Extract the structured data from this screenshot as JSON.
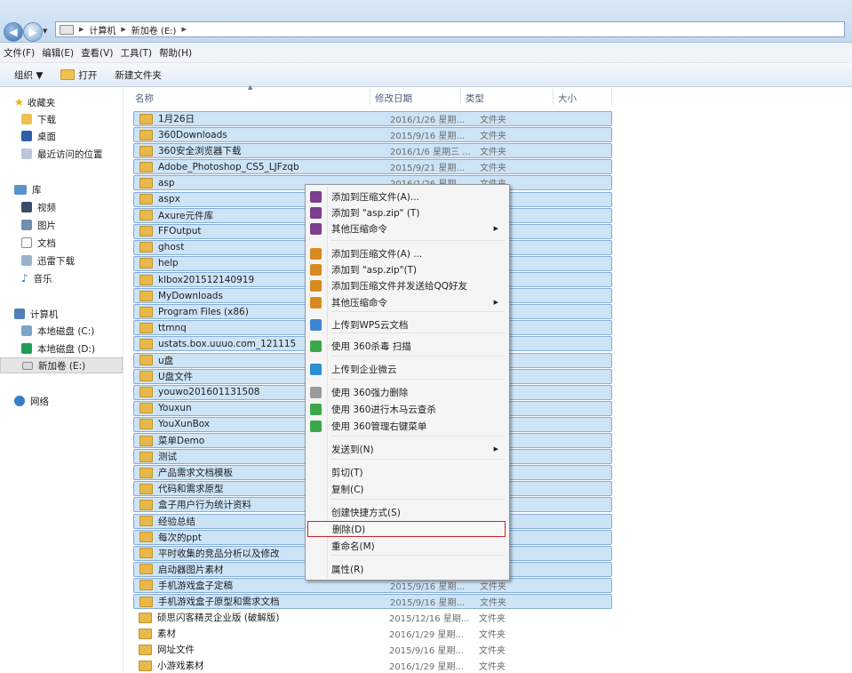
{
  "address": {
    "crumbs": [
      "计算机",
      "新加卷 (E:)"
    ]
  },
  "menubar": [
    "文件(F)",
    "编辑(E)",
    "查看(V)",
    "工具(T)",
    "帮助(H)"
  ],
  "toolbar": {
    "organize": "组织 ▼",
    "open": "打开",
    "new_folder": "新建文件夹"
  },
  "nav": {
    "favorites": "收藏夹",
    "downloads": "下载",
    "desktop": "桌面",
    "recent": "最近访问的位置",
    "libraries": "库",
    "videos": "视频",
    "pictures": "图片",
    "documents": "文档",
    "xunlei": "迅雷下载",
    "music": "音乐",
    "computer": "计算机",
    "drive_c": "本地磁盘 (C:)",
    "drive_d": "本地磁盘 (D:)",
    "drive_e": "新加卷 (E:)",
    "network": "网络"
  },
  "columns": {
    "name": "名称",
    "date": "修改日期",
    "type": "类型",
    "size": "大小"
  },
  "files": [
    {
      "name": "1月26日",
      "date": "2016/1/26 星期...",
      "type": "文件夹",
      "selected": true
    },
    {
      "name": "360Downloads",
      "date": "2015/9/16 星期...",
      "type": "文件夹",
      "selected": true
    },
    {
      "name": "360安全浏览器下载",
      "date": "2016/1/6 星期三 ...",
      "type": "文件夹",
      "selected": true
    },
    {
      "name": "Adobe_Photoshop_CS5_LJFzqb",
      "date": "2015/9/21 星期...",
      "type": "文件夹",
      "selected": true
    },
    {
      "name": "asp",
      "date": "2016/1/26 星期...",
      "type": "文件夹",
      "selected": true
    },
    {
      "name": "aspx",
      "date": "",
      "type": "",
      "selected": true
    },
    {
      "name": "Axure元件库",
      "date": "",
      "type": "",
      "selected": true
    },
    {
      "name": "FFOutput",
      "date": "",
      "type": "",
      "selected": true
    },
    {
      "name": "ghost",
      "date": "",
      "type": "",
      "selected": true
    },
    {
      "name": "help",
      "date": "",
      "type": "",
      "selected": true
    },
    {
      "name": "klbox201512140919",
      "date": "",
      "type": "",
      "selected": true
    },
    {
      "name": "MyDownloads",
      "date": "",
      "type": "",
      "selected": true
    },
    {
      "name": "Program Files (x86)",
      "date": "",
      "type": "",
      "selected": true
    },
    {
      "name": "ttmnq",
      "date": "",
      "type": "",
      "selected": true
    },
    {
      "name": "ustats.box.uuuo.com_121115",
      "date": "",
      "type": "",
      "selected": true
    },
    {
      "name": "u盘",
      "date": "",
      "type": "",
      "selected": true
    },
    {
      "name": "U盘文件",
      "date": "",
      "type": "",
      "selected": true
    },
    {
      "name": "youwo201601131508",
      "date": "",
      "type": "",
      "selected": true
    },
    {
      "name": "Youxun",
      "date": "",
      "type": "",
      "selected": true
    },
    {
      "name": "YouXunBox",
      "date": "",
      "type": "",
      "selected": true
    },
    {
      "name": "菜单Demo",
      "date": "",
      "type": "",
      "selected": true
    },
    {
      "name": "测试",
      "date": "",
      "type": "",
      "selected": true
    },
    {
      "name": "产品需求文档模板",
      "date": "",
      "type": "",
      "selected": true
    },
    {
      "name": "代码和需求原型",
      "date": "",
      "type": "",
      "selected": true
    },
    {
      "name": "盒子用户行为统计资料",
      "date": "",
      "type": "",
      "selected": true
    },
    {
      "name": "经验总结",
      "date": "",
      "type": "",
      "selected": true
    },
    {
      "name": "每次的ppt",
      "date": "",
      "type": "",
      "selected": true
    },
    {
      "name": "平时收集的竞品分析以及修改",
      "date": "",
      "type": "",
      "selected": true
    },
    {
      "name": "启动器图片素材",
      "date": "",
      "type": "",
      "selected": true
    },
    {
      "name": "手机游戏盒子定稿",
      "date": "2015/9/16 星期...",
      "type": "文件夹",
      "selected": true
    },
    {
      "name": "手机游戏盒子原型和需求文档",
      "date": "2015/9/16 星期...",
      "type": "文件夹",
      "selected": true
    },
    {
      "name": "硕思闪客精灵企业版 (破解版)",
      "date": "2015/12/16 星期...",
      "type": "文件夹",
      "selected": false
    },
    {
      "name": "素材",
      "date": "2016/1/29 星期...",
      "type": "文件夹",
      "selected": false
    },
    {
      "name": "网址文件",
      "date": "2015/9/16 星期...",
      "type": "文件夹",
      "selected": false
    },
    {
      "name": "小游戏素材",
      "date": "2016/1/29 星期...",
      "type": "文件夹",
      "selected": false
    }
  ],
  "context_menu": {
    "items": [
      {
        "label": "添加到压缩文件(A)...",
        "icon": "winrar-icon",
        "sub": false
      },
      {
        "label": "添加到 \"asp.zip\" (T)",
        "icon": "winrar-icon",
        "sub": false
      },
      {
        "label": "其他压缩命令",
        "icon": "winrar-icon",
        "sub": true
      },
      {
        "label": "添加到压缩文件(A) ...",
        "icon": "archive-icon",
        "sub": false
      },
      {
        "label": "添加到 \"asp.zip\"(T)",
        "icon": "archive-icon",
        "sub": false
      },
      {
        "label": "添加到压缩文件并发送给QQ好友",
        "icon": "archive-icon",
        "sub": false
      },
      {
        "label": "其他压缩命令",
        "icon": "archive-icon",
        "sub": true
      },
      {
        "label": "上传到WPS云文档",
        "icon": "wps-cloud-icon",
        "sub": false
      },
      {
        "label": "使用 360杀毒 扫描",
        "icon": "360-shield-icon",
        "sub": false
      },
      {
        "label": "上传到企业微云",
        "icon": "weiyun-icon",
        "sub": false
      },
      {
        "label": "使用 360强力删除",
        "icon": "shredder-icon",
        "sub": false
      },
      {
        "label": "使用 360进行木马云查杀",
        "icon": "360-trojan-icon",
        "sub": false
      },
      {
        "label": "使用 360管理右键菜单",
        "icon": "360-menu-icon",
        "sub": false
      },
      {
        "label": "发送到(N)",
        "icon": "",
        "sub": true
      },
      {
        "label": "剪切(T)",
        "icon": "",
        "sub": false
      },
      {
        "label": "复制(C)",
        "icon": "",
        "sub": false
      },
      {
        "label": "创建快捷方式(S)",
        "icon": "",
        "sub": false
      },
      {
        "label": "删除(D)",
        "icon": "",
        "sub": false,
        "highlighted": true
      },
      {
        "label": "重命名(M)",
        "icon": "",
        "sub": false
      },
      {
        "label": "属性(R)",
        "icon": "",
        "sub": false
      }
    ]
  },
  "colors": {
    "selection_bg": "#cde4f7",
    "selection_border": "#84acdd",
    "highlight_border": "#c8252b",
    "folder": "#e8b84a"
  }
}
